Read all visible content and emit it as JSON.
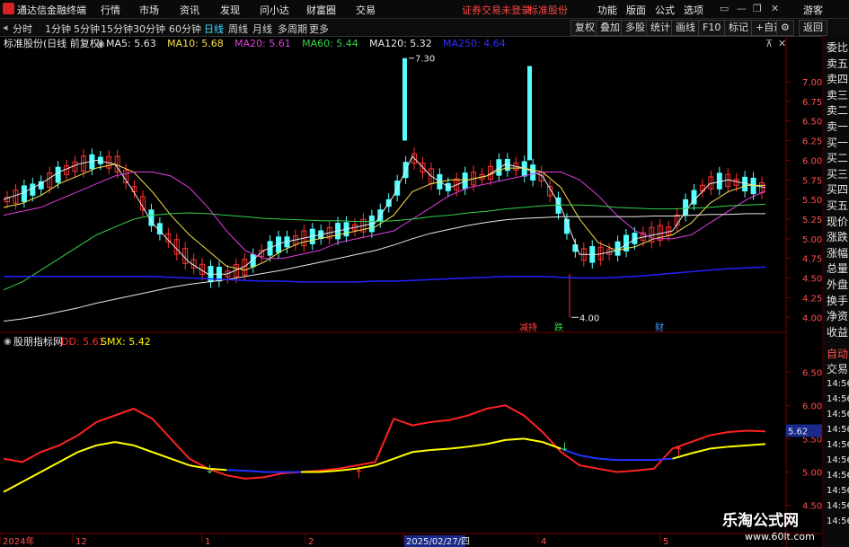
{
  "app": {
    "title": "通达信金融终端",
    "brand_color": "#d32323"
  },
  "menu": [
    "行情",
    "市场",
    "资讯",
    "发现",
    "问小达",
    "财富圈",
    "交易"
  ],
  "notice": [
    "证券交易未登录",
    "标准股份"
  ],
  "right_menu": [
    "功能",
    "版面",
    "公式",
    "选项"
  ],
  "guest": "游客",
  "periods": [
    {
      "label": "分时",
      "active": false
    },
    {
      "label": "1分钟",
      "active": false
    },
    {
      "label": "5分钟",
      "active": false
    },
    {
      "label": "15分钟",
      "active": false
    },
    {
      "label": "30分钟",
      "active": false
    },
    {
      "label": "60分钟",
      "active": false
    },
    {
      "label": "日线",
      "active": true
    },
    {
      "label": "周线",
      "active": false
    },
    {
      "label": "月线",
      "active": false
    },
    {
      "label": "多周期",
      "active": false
    },
    {
      "label": "更多",
      "active": false
    }
  ],
  "tool_buttons": [
    "复权",
    "叠加",
    "多股",
    "统计",
    "画线",
    "F10",
    "标记",
    "+自选",
    "返回"
  ],
  "main_chart": {
    "title": "标准股份(日线 前复权)",
    "ma_labels": [
      {
        "text": "MA5: 5.63",
        "color": "#e8e8e8"
      },
      {
        "text": "MA10: 5.68",
        "color": "#f7e04a"
      },
      {
        "text": "MA20: 5.61",
        "color": "#e23de0"
      },
      {
        "text": "MA60: 5.44",
        "color": "#33d24a"
      },
      {
        "text": "MA120: 5.32",
        "color": "#e8e8e8"
      },
      {
        "text": "MA250: 4.64",
        "color": "#3030ff"
      }
    ],
    "ticks": [
      "7.00",
      "6.75",
      "6.50",
      "6.25",
      "6.00",
      "5.75",
      "5.50",
      "5.25",
      "5.00",
      "4.75",
      "4.50",
      "4.25",
      "4.00"
    ],
    "high_label": "7.30",
    "low_label": "4.00",
    "events": [
      {
        "label": "减持",
        "color": "#ff4545"
      },
      {
        "label": "跌",
        "color": "#33d24a"
      },
      {
        "label": "财",
        "color": "#3fa0ff"
      }
    ]
  },
  "indicator": {
    "title": "股朋指标网",
    "dd_label": "DD: 5.61",
    "smx_label": "SMX: 5.42",
    "ticks": [
      "6.50",
      "6.00",
      "5.50",
      "5.00",
      "4.50"
    ],
    "current_value": "5.62"
  },
  "date_axis": [
    "2024年",
    "12",
    "1",
    "2",
    "2025/02/27/四",
    "4",
    "5"
  ],
  "right_panel": {
    "order_book": [
      "委比",
      "卖五",
      "卖四",
      "卖三",
      "卖二",
      "卖一",
      "买一",
      "买二",
      "买三",
      "买四",
      "买五",
      "现价",
      "涨跌",
      "涨幅",
      "总量",
      "外盘",
      "换手",
      "净资",
      "收益"
    ],
    "auto_label": "自动",
    "trade_label": "交易",
    "times": [
      "14:56",
      "14:56",
      "14:56",
      "14:56",
      "14:56",
      "14:56",
      "14:56",
      "14:56",
      "14:56",
      "14:56"
    ]
  },
  "watermark": {
    "text": "乐淘公式网",
    "url": "www.60lt.com"
  },
  "colors": {
    "up": "#ff3232",
    "down": "#54ffff",
    "dd": "#ff2222",
    "smx_up": "#ffff00",
    "smx_down": "#2233ff",
    "axis": "#7a0000"
  },
  "chart_data": {
    "type": "line",
    "candles_summary": {
      "high": 7.3,
      "low": 4.0,
      "last_ma5": 5.63
    },
    "ylim": [
      3.9,
      7.4
    ],
    "dd_ylim": [
      4.4,
      6.8
    ],
    "series": [
      {
        "name": "MA5",
        "values": [
          5.5,
          5.58,
          5.7,
          5.85,
          5.95,
          6.0,
          5.95,
          5.6,
          5.2,
          4.95,
          4.7,
          4.55,
          4.55,
          4.65,
          4.85,
          4.95,
          5.0,
          5.05,
          5.1,
          5.15,
          5.2,
          5.55,
          6.05,
          5.8,
          5.65,
          5.75,
          5.8,
          5.95,
          5.9,
          5.8,
          5.4,
          4.8,
          4.8,
          4.85,
          5.0,
          5.05,
          5.1,
          5.45,
          5.7,
          5.75,
          5.7,
          5.65
        ]
      },
      {
        "name": "MA10",
        "values": [
          5.4,
          5.45,
          5.55,
          5.7,
          5.8,
          5.9,
          5.95,
          5.85,
          5.6,
          5.3,
          5.05,
          4.85,
          4.65,
          4.6,
          4.7,
          4.85,
          4.95,
          5.0,
          5.05,
          5.1,
          5.15,
          5.3,
          5.6,
          5.7,
          5.75,
          5.75,
          5.8,
          5.9,
          5.9,
          5.85,
          5.65,
          5.25,
          4.95,
          4.85,
          4.9,
          5.0,
          5.05,
          5.2,
          5.45,
          5.6,
          5.68,
          5.68
        ]
      },
      {
        "name": "MA20",
        "values": [
          5.3,
          5.35,
          5.4,
          5.5,
          5.6,
          5.7,
          5.8,
          5.85,
          5.85,
          5.8,
          5.65,
          5.4,
          5.1,
          4.85,
          4.75,
          4.75,
          4.8,
          4.85,
          4.95,
          5.0,
          5.05,
          5.1,
          5.25,
          5.4,
          5.55,
          5.65,
          5.7,
          5.75,
          5.8,
          5.85,
          5.85,
          5.75,
          5.55,
          5.3,
          5.1,
          5.0,
          5.0,
          5.05,
          5.2,
          5.35,
          5.5,
          5.61
        ]
      },
      {
        "name": "MA60",
        "values": [
          4.35,
          4.45,
          4.6,
          4.75,
          4.9,
          5.05,
          5.15,
          5.25,
          5.3,
          5.32,
          5.33,
          5.32,
          5.3,
          5.28,
          5.26,
          5.25,
          5.24,
          5.23,
          5.23,
          5.22,
          5.22,
          5.23,
          5.25,
          5.28,
          5.3,
          5.33,
          5.35,
          5.38,
          5.4,
          5.42,
          5.43,
          5.43,
          5.42,
          5.4,
          5.39,
          5.38,
          5.38,
          5.39,
          5.4,
          5.42,
          5.43,
          5.44
        ]
      },
      {
        "name": "MA120",
        "values": [
          3.95,
          3.98,
          4.02,
          4.07,
          4.12,
          4.18,
          4.23,
          4.28,
          4.33,
          4.38,
          4.42,
          4.45,
          4.48,
          4.52,
          4.56,
          4.6,
          4.65,
          4.7,
          4.75,
          4.8,
          4.85,
          4.92,
          5.0,
          5.07,
          5.12,
          5.17,
          5.21,
          5.24,
          5.26,
          5.27,
          5.28,
          5.28,
          5.28,
          5.28,
          5.28,
          5.29,
          5.29,
          5.3,
          5.31,
          5.31,
          5.32,
          5.32
        ]
      },
      {
        "name": "MA250",
        "values": [
          4.52,
          4.52,
          4.52,
          4.52,
          4.52,
          4.52,
          4.52,
          4.52,
          4.52,
          4.51,
          4.5,
          4.49,
          4.48,
          4.47,
          4.46,
          4.46,
          4.45,
          4.45,
          4.45,
          4.45,
          4.46,
          4.46,
          4.47,
          4.48,
          4.49,
          4.5,
          4.51,
          4.52,
          4.52,
          4.52,
          4.51,
          4.5,
          4.5,
          4.51,
          4.52,
          4.54,
          4.56,
          4.58,
          4.6,
          4.62,
          4.63,
          4.64
        ]
      },
      {
        "name": "DD",
        "values": [
          5.2,
          5.15,
          5.3,
          5.4,
          5.55,
          5.75,
          5.85,
          5.95,
          5.8,
          5.5,
          5.2,
          5.05,
          4.95,
          4.9,
          4.92,
          4.98,
          5.0,
          5.02,
          5.05,
          5.1,
          5.15,
          5.8,
          5.7,
          5.75,
          5.78,
          5.85,
          5.95,
          6.0,
          5.85,
          5.6,
          5.3,
          5.1,
          5.05,
          5.0,
          5.02,
          5.05,
          5.35,
          5.45,
          5.55,
          5.6,
          5.62,
          5.61
        ]
      },
      {
        "name": "SMX",
        "values": [
          4.7,
          4.85,
          5.0,
          5.15,
          5.3,
          5.4,
          5.45,
          5.4,
          5.3,
          5.2,
          5.1,
          5.05,
          5.03,
          5.02,
          5.0,
          5.0,
          5.0,
          5.0,
          5.02,
          5.05,
          5.1,
          5.2,
          5.3,
          5.33,
          5.35,
          5.38,
          5.42,
          5.48,
          5.5,
          5.45,
          5.35,
          5.25,
          5.2,
          5.18,
          5.18,
          5.18,
          5.2,
          5.28,
          5.35,
          5.38,
          5.4,
          5.42
        ]
      }
    ]
  }
}
